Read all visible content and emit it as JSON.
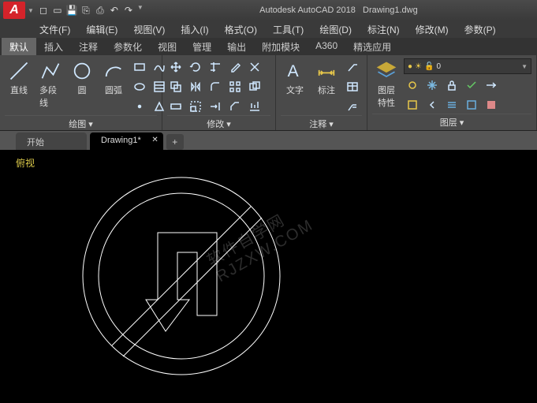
{
  "title": {
    "app": "Autodesk AutoCAD 2018",
    "doc": "Drawing1.dwg"
  },
  "logo": "A",
  "menus": [
    "文件(F)",
    "编辑(E)",
    "视图(V)",
    "插入(I)",
    "格式(O)",
    "工具(T)",
    "绘图(D)",
    "标注(N)",
    "修改(M)",
    "参数(P)"
  ],
  "ribbonTabs": [
    "默认",
    "插入",
    "注释",
    "参数化",
    "视图",
    "管理",
    "输出",
    "附加模块",
    "A360",
    "精选应用"
  ],
  "panels": {
    "draw": {
      "title": "绘图 ▾",
      "line": "直线",
      "polyline": "多段线",
      "circle": "圆",
      "arc": "圆弧"
    },
    "modify": {
      "title": "修改 ▾"
    },
    "annotate": {
      "title": "注释 ▾",
      "text": "文字",
      "dim": "标注"
    },
    "layer": {
      "title": "图层 ▾",
      "props": "图层\n特性",
      "current": "0"
    }
  },
  "docTabs": {
    "start": "开始",
    "d1": "Drawing1*"
  },
  "viewLabel": "俯视",
  "watermark": "软件自学网\nRJZXW.COM"
}
